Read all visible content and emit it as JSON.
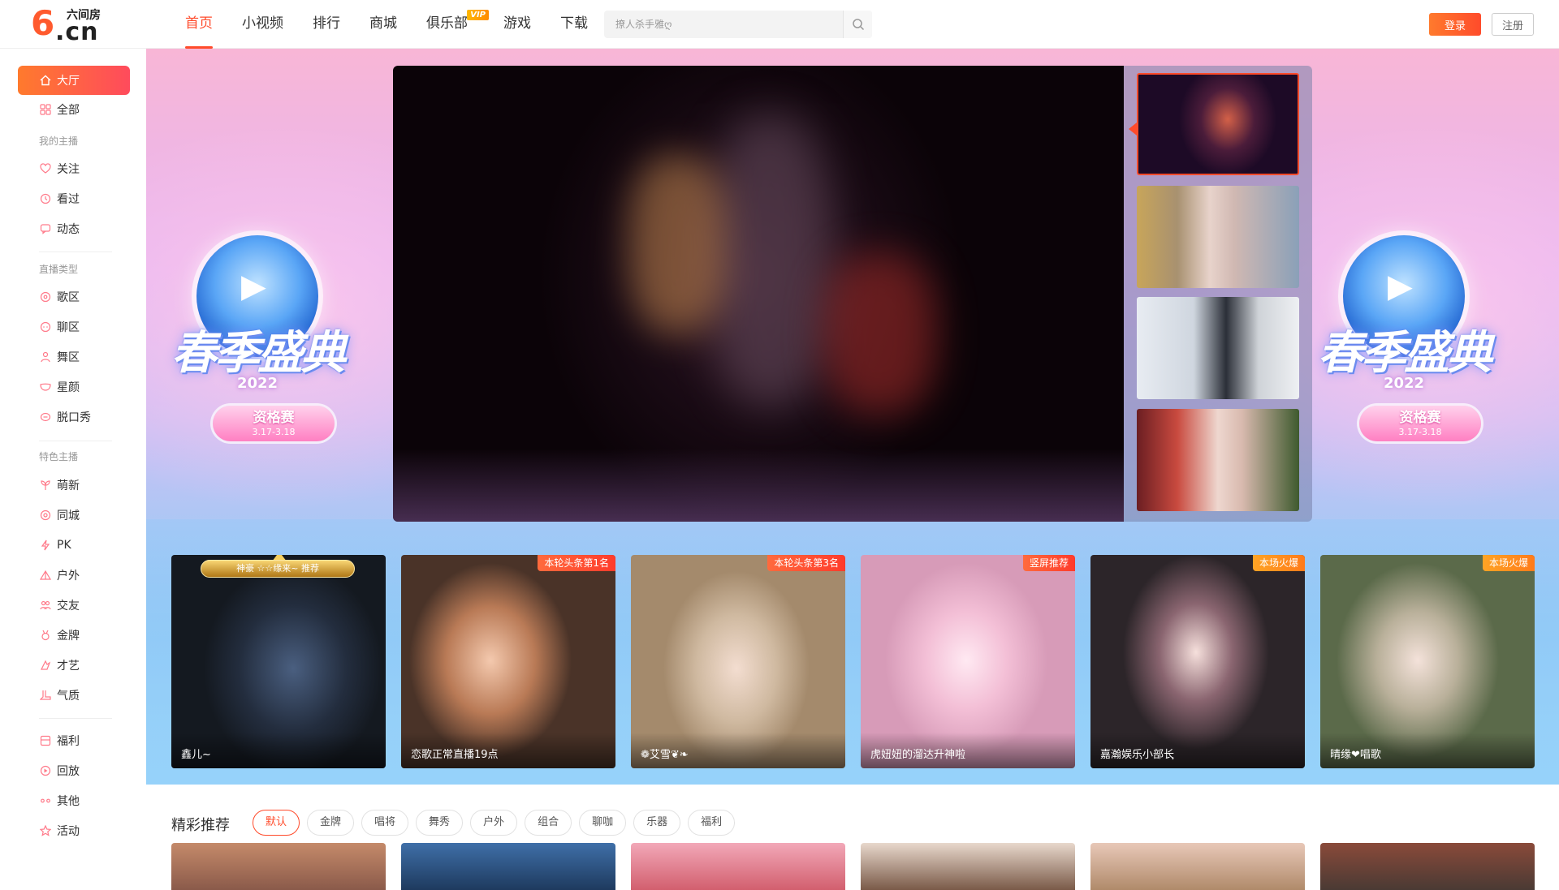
{
  "header": {
    "logo": {
      "brand": "六间房",
      "six": "6",
      "domain": ".cn"
    },
    "nav": [
      {
        "label": "首页"
      },
      {
        "label": "小视频"
      },
      {
        "label": "排行"
      },
      {
        "label": "商城"
      },
      {
        "label": "俱乐部",
        "badge": "VIP"
      },
      {
        "label": "游戏"
      },
      {
        "label": "下载"
      }
    ],
    "search": {
      "placeholder": "撩人杀手雅ღ"
    },
    "login_label": "登录",
    "register_label": "注册",
    "accent_color": "#ff4b2b"
  },
  "sidebar": {
    "top": [
      {
        "label": "大厅",
        "icon": "home-icon"
      },
      {
        "label": "全部",
        "icon": "grid-icon"
      }
    ],
    "groups": [
      {
        "title": "我的主播",
        "items": [
          {
            "label": "关注",
            "icon": "heart-icon"
          },
          {
            "label": "看过",
            "icon": "clock-icon"
          },
          {
            "label": "动态",
            "icon": "message-icon"
          }
        ]
      },
      {
        "title": "直播类型",
        "items": [
          {
            "label": "歌区",
            "icon": "music-icon"
          },
          {
            "label": "聊区",
            "icon": "chat-icon"
          },
          {
            "label": "舞区",
            "icon": "dance-icon"
          },
          {
            "label": "星颜",
            "icon": "mask-icon"
          },
          {
            "label": "脱口秀",
            "icon": "talk-icon"
          }
        ]
      },
      {
        "title": "特色主播",
        "items": [
          {
            "label": "萌新",
            "icon": "sprout-icon"
          },
          {
            "label": "同城",
            "icon": "location-icon"
          },
          {
            "label": "PK",
            "icon": "lightning-icon"
          },
          {
            "label": "户外",
            "icon": "tent-icon"
          },
          {
            "label": "交友",
            "icon": "friends-icon"
          },
          {
            "label": "金牌",
            "icon": "medal-icon"
          },
          {
            "label": "才艺",
            "icon": "talent-icon"
          },
          {
            "label": "气质",
            "icon": "boot-icon"
          }
        ]
      }
    ],
    "bottom": [
      {
        "label": "福利",
        "icon": "gift-icon"
      },
      {
        "label": "回放",
        "icon": "replay-icon"
      },
      {
        "label": "其他",
        "icon": "more-icon"
      },
      {
        "label": "活动",
        "icon": "star-icon"
      }
    ]
  },
  "banner": {
    "event_title": "春季盛典",
    "event_year": "2022",
    "event_stage": "资格赛",
    "event_dates": "3.17-3.18"
  },
  "featured": [
    {
      "name": "鑫儿~",
      "crown": "神豪 ☆☆缘来~ 推荐",
      "tag": ""
    },
    {
      "name": "恋歌正常直播19点",
      "tag": "本轮头条第1名",
      "tag_style": "red"
    },
    {
      "name": "❁艾雪❦❧",
      "tag": "本轮头条第3名",
      "tag_style": "red"
    },
    {
      "name": "虎妞妞的溜达升神啦",
      "tag": "竖屏推荐",
      "tag_style": "red"
    },
    {
      "name": "嘉瀚娱乐ฺ小部长ฺ",
      "tag": "本场火爆",
      "tag_style": "orange"
    },
    {
      "name": "晴缘❤唱歌",
      "tag": "本场火爆",
      "tag_style": "orange"
    }
  ],
  "recommend": {
    "title": "精彩推荐",
    "filters": [
      "默认",
      "金牌",
      "唱将",
      "舞秀",
      "户外",
      "组合",
      "聊咖",
      "乐器",
      "福利"
    ]
  }
}
